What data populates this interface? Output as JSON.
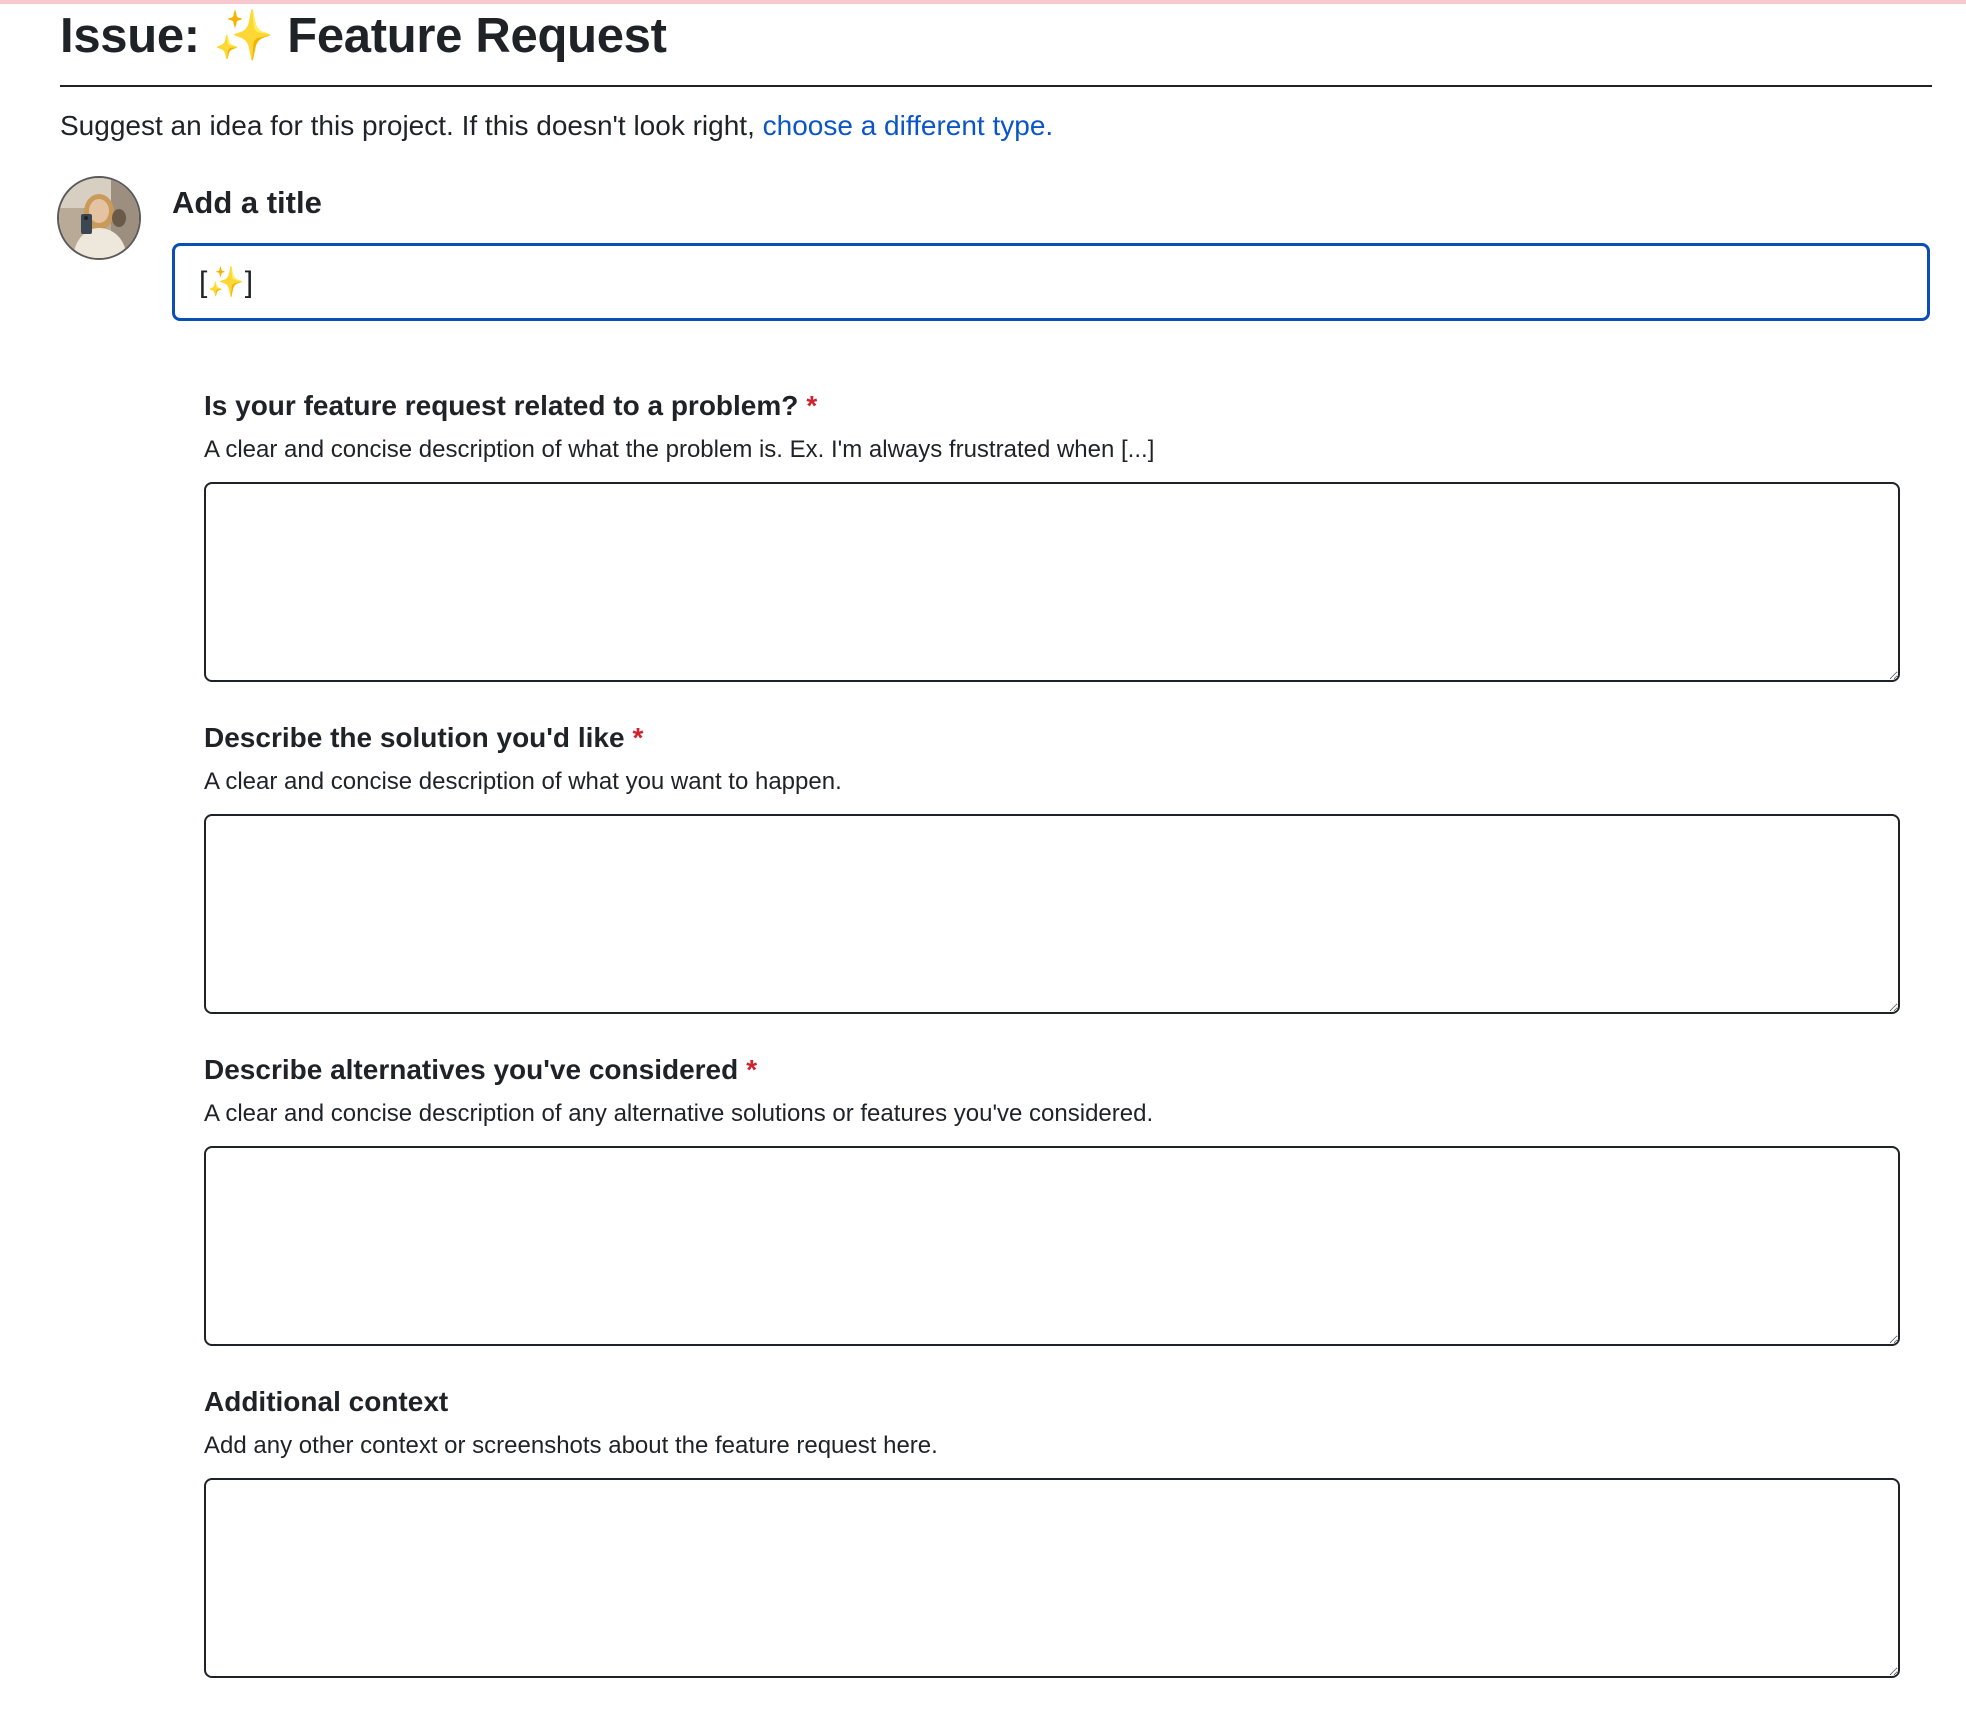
{
  "page": {
    "title_prefix": "Issue:",
    "title_emoji": "✨",
    "title_text": "Feature Request",
    "intro_text": "Suggest an idea for this project. If this doesn't look right, ",
    "intro_link": "choose a different type."
  },
  "title_section": {
    "label": "Add a title",
    "input_value": "[✨]"
  },
  "fields": [
    {
      "label": "Is your feature request related to a problem?",
      "required_marker": "*",
      "description": "A clear and concise description of what the problem is. Ex. I'm always frustrated when [...]",
      "value": ""
    },
    {
      "label": "Describe the solution you'd like",
      "required_marker": "*",
      "description": "A clear and concise description of what you want to happen.",
      "value": ""
    },
    {
      "label": "Describe alternatives you've considered",
      "required_marker": "*",
      "description": "A clear and concise description of any alternative solutions or features you've considered.",
      "value": ""
    },
    {
      "label": "Additional context",
      "required_marker": "",
      "description": "Add any other context or screenshots about the feature request here.",
      "value": ""
    }
  ],
  "colors": {
    "link": "#0a56c6",
    "required": "#cf222e",
    "focus_border": "#0a4fb5",
    "text": "#1f2328"
  },
  "icons": {
    "avatar": "user-avatar-photo",
    "sparkle": "sparkles-emoji"
  }
}
